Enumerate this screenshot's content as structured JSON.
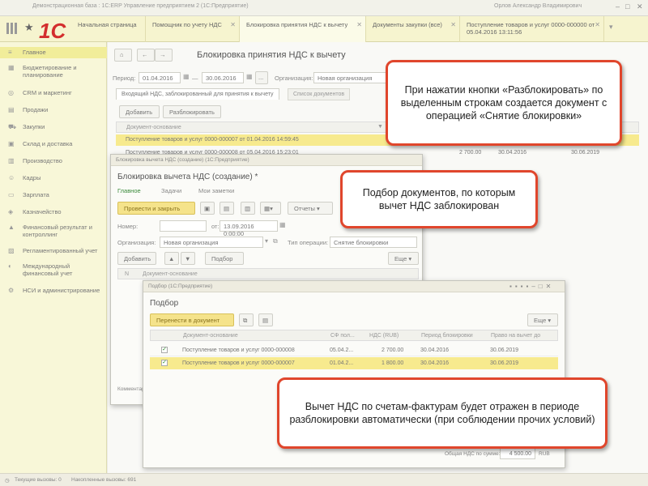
{
  "window": {
    "title": "Демонстрационная база : 1С:ERP Управление предприятием 2 (1С:Предприятие)",
    "user": "Орлов Александр Владимирович"
  },
  "top_tabs": [
    {
      "label": "Начальная страница"
    },
    {
      "label": "Помощник по учету НДС"
    },
    {
      "label": "Блокировка принятия НДС к вычету"
    },
    {
      "label": "Документы закупки (все)"
    },
    {
      "label": "Поступление товаров и услуг 0000-000000 от 05.04.2016 13:11:56"
    }
  ],
  "sidebar": {
    "items": [
      {
        "label": "Главное",
        "icon": "menu-icon"
      },
      {
        "label": "Бюджетирование и планирование",
        "icon": "budget-icon"
      },
      {
        "label": "CRM и маркетинг",
        "icon": "crm-icon"
      },
      {
        "label": "Продажи",
        "icon": "sales-icon"
      },
      {
        "label": "Закупки",
        "icon": "cart-icon"
      },
      {
        "label": "Склад и доставка",
        "icon": "warehouse-icon"
      },
      {
        "label": "Производство",
        "icon": "factory-icon"
      },
      {
        "label": "Кадры",
        "icon": "people-icon"
      },
      {
        "label": "Зарплата",
        "icon": "salary-icon"
      },
      {
        "label": "Казначейство",
        "icon": "treasury-icon"
      },
      {
        "label": "Финансовый результат и контроллинг",
        "icon": "finance-icon"
      },
      {
        "label": "Регламентированный учет",
        "icon": "accounting-icon"
      },
      {
        "label": "Международный финансовый учет",
        "icon": "intl-icon"
      },
      {
        "label": "НСИ и администрирование",
        "icon": "settings-icon"
      }
    ]
  },
  "main": {
    "title": "Блокировка принятия НДС к вычету",
    "period_label": "Период:",
    "period_from": "01.04.2016",
    "period_sep": "—",
    "period_to": "30.06.2016",
    "org_label": "Организация:",
    "org_value": "Новая организация",
    "tabs": [
      {
        "label": "Входящий НДС, заблокированный для принятия к вычету"
      },
      {
        "label": "Список документов"
      }
    ],
    "add_button": "Добавить",
    "unblock_button": "Разблокировать",
    "columns": [
      "Документ-основание"
    ],
    "rows": [
      {
        "doc": "Поступление товаров и услуг 0000-000007 от 01.04.2016 14:59:45",
        "sum": "",
        "date1": "",
        "date2": ""
      },
      {
        "doc": "Поступление товаров и услуг 0000-000008 от 05.04.2016 15:23:01",
        "sum": "2 700.00",
        "date1": "30.04.2016",
        "date2": "30.06.2019"
      }
    ]
  },
  "block_window": {
    "app_title": "Блокировка вычета НДС (создание) (1С:Предприятие)",
    "title": "Блокировка вычета НДС (создание) *",
    "tabs": [
      "Главное",
      "Задачи",
      "Мои заметки"
    ],
    "post_close": "Провести и закрыть",
    "reports": "Отчеты",
    "number_label": "Номер:",
    "date_label": "от:",
    "date_value": "13.09.2016  0:00:00",
    "org_label": "Организация:",
    "org_value": "Новая организация",
    "op_label": "Тип операции:",
    "op_value": "Снятие блокировки",
    "add_button": "Добавить",
    "select_button": "Подбор",
    "more_button": "Еще",
    "col_n": "N",
    "col_doc": "Документ-основание",
    "comment_label": "Комментарий:"
  },
  "pick_window": {
    "app_title": "Подбор (1С:Предприятие)",
    "title": "Подбор",
    "transfer_button": "Перенести в документ",
    "more_button": "Еще",
    "columns": [
      "Документ-основание",
      "СФ пол...",
      "НДС (RUB)",
      "Период блокировки",
      "Право на вычет до"
    ],
    "rows": [
      {
        "doc": "Поступление товаров и услуг 0000-000008",
        "sf": "05.04.2...",
        "vat": "2 700.00",
        "period": "30.04.2016",
        "until": "30.06.2019"
      },
      {
        "doc": "Поступление товаров и услуг 0000-000007",
        "sf": "01.04.2...",
        "vat": "1 800.00",
        "period": "30.04.2016",
        "until": "30.06.2019"
      }
    ],
    "total_label": "Общая НДС по сумме:",
    "total_value": "4 500.00",
    "currency": "RUB"
  },
  "callouts": {
    "c1": "При нажатии кнопки «Разблокировать» по выделенным строкам создается документ с операцией «Снятие блокировки»",
    "c2": "Подбор документов, по которым вычет НДС заблокирован",
    "c3": "Вычет НДС по счетам-фактурам будет отражен в периоде разблокировки автоматически (при соблюдении прочих условий)"
  },
  "statusbar": {
    "current_calls": "Текущие вызовы: 0",
    "accumulated_calls": "Накопленные вызовы: 691"
  },
  "colors": {
    "accent": "#e0462c",
    "highlight": "#f1ed9a",
    "logo": "#d32e2e"
  }
}
